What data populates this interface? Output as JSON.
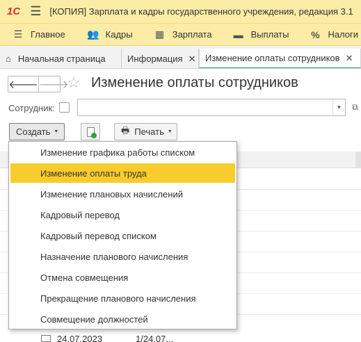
{
  "titlebar": {
    "logo": "1С",
    "menu_icon": "hamburger-icon",
    "title": "[КОПИЯ] Зарплата и кадры государственного учреждения, редакция 3.1"
  },
  "sections": [
    {
      "label": "Главное",
      "icon": "hamburger-icon"
    },
    {
      "label": "Кадры",
      "icon": "people-icon"
    },
    {
      "label": "Зарплата",
      "icon": "calculator-icon"
    },
    {
      "label": "Выплаты",
      "icon": "wallet-icon"
    },
    {
      "label": "Налоги",
      "icon": "percent-icon"
    }
  ],
  "tabs": {
    "home": "Начальная страница",
    "info": "Информация",
    "active": "Изменение оплаты сотрудников"
  },
  "page": {
    "title": "Изменение оплаты сотрудников",
    "employee_label": "Сотрудник:",
    "employee_value": ""
  },
  "toolbar": {
    "create_label": "Создать",
    "print_label": "Печать"
  },
  "create_menu": {
    "items": [
      "Изменение графика работы списком",
      "Изменение оплаты труда",
      "Изменение плановых начислений",
      "Кадровый перевод",
      "Кадровый перевод списком",
      "Назначение планового начисления",
      "Отмена совмещения",
      "Прекращение планового начисления",
      "Совмещение должностей"
    ],
    "selected_index": 1
  },
  "list": {
    "visible_row": {
      "date": "24.07.2023",
      "value": "1/24.07..."
    }
  },
  "colors": {
    "header_bg": "#fbeca6",
    "logo": "#d8302e",
    "highlight": "#f8cc2d",
    "active_tab_underline": "#23a887"
  }
}
